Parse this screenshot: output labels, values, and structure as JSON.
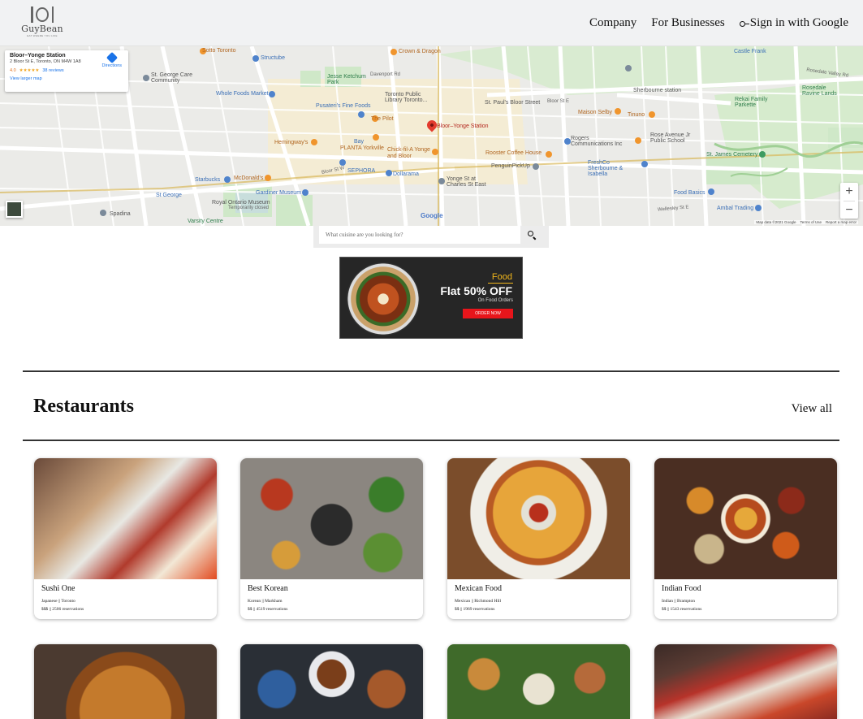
{
  "header": {
    "logo_name": "GuyBean",
    "logo_tagline": "EAT WHERE YOU LIKE",
    "nav": {
      "company": "Company",
      "businesses": "For Businesses",
      "signin": "Sign in with Google"
    }
  },
  "map": {
    "infocard": {
      "title": "Bloor–Yonge Station",
      "address": "2 Bloor St E, Toronto, ON M4W 1A8",
      "rating": "4.0",
      "stars": "★★★★★",
      "reviews": "38 reviews",
      "larger": "View larger map",
      "directions": "Directions"
    },
    "marker_label": "Bloor–Yonge Station",
    "google": "Google",
    "attribution": {
      "data": "Map data ©2021 Google",
      "terms": "Terms of Use",
      "report": "Report a map error"
    },
    "labels": {
      "sotto": "Sotto Toronto",
      "structube": "Structube",
      "crown": "Crown & Dragon",
      "rosedale_valley": "Rosedale Valley Rd",
      "castle_frank": "Castle Frank",
      "george_care": "St. George Care Community",
      "jesse": "Jesse Ketchum Park",
      "davenport": "Davenport Rd",
      "library": "Toronto Public Library Toronto...",
      "sherbourne": "Sherbourne station",
      "rosedale_park": "Rosedale Valley Rd",
      "wholefoods": "Whole Foods Market",
      "pusateri": "Pusateri's Fine Foods",
      "st_pauls": "St. Paul's Bloor Street",
      "bloor_east": "Bloor St E",
      "maison": "Maison Selby",
      "tinuno": "Tinuno",
      "rekai": "Rekai Family Parkette",
      "rosedale_family": "Rosedale Ravine Lands",
      "pilot": "The Pilot",
      "hemingway": "Hemingway's",
      "planta": "PLANTA Yorkville",
      "chickfila": "Chick-fil-A Yonge and Bloor",
      "rooster": "Rooster Coffee House",
      "rogers": "Rogers Communications Inc",
      "rose_avenue": "Rose Avenue Jr Public School",
      "st_james": "St. James Cemetery",
      "penguin": "PenguinPickUp",
      "freshco": "FreshCo Sherbourne & Isabella",
      "starbucks": "Starbucks",
      "mcdonalds": "McDonald's",
      "sephora": "SEPHORA",
      "dollarama": "Dollarama",
      "yonge_charles": "Yonge St at Charles St East",
      "food_basics": "Food Basics",
      "st_george": "St George",
      "gardiner": "Gardiner Museum",
      "rom": "Royal Ontario Museum",
      "rom_sub": "Temporarily closed",
      "bay": "Bay",
      "ambal": "Ambal Trading",
      "spadina": "Spadina",
      "varsity": "Varsity Centre",
      "bloor_st_w": "Bloor St W",
      "wellesley": "Wellesley St E"
    }
  },
  "search": {
    "placeholder": "What cuisine are you looking for?"
  },
  "ad": {
    "brand": "Food",
    "offer": "Flat 50% OFF",
    "sub": "On Food Orders",
    "cta": "ORDER NOW"
  },
  "section": {
    "title": "Restaurants",
    "view_all": "View all"
  },
  "restaurants": [
    {
      "name": "Sushi One",
      "meta": "Japanese || Toronto",
      "meta2": "$$$ || 2506 reservations"
    },
    {
      "name": "Best Korean",
      "meta": "Korean || Markham",
      "meta2": "$$ || 4519 reservations"
    },
    {
      "name": "Mexican Food",
      "meta": "Mexican || Richmond Hill",
      "meta2": "$$ || 1969 reservations"
    },
    {
      "name": "Indian Food",
      "meta": "Indian || Brampton",
      "meta2": "$$ || 1543 reservations"
    },
    {
      "name": "",
      "meta": "",
      "meta2": ""
    },
    {
      "name": "",
      "meta": "",
      "meta2": ""
    },
    {
      "name": "",
      "meta": "",
      "meta2": ""
    },
    {
      "name": "",
      "meta": "",
      "meta2": ""
    }
  ]
}
